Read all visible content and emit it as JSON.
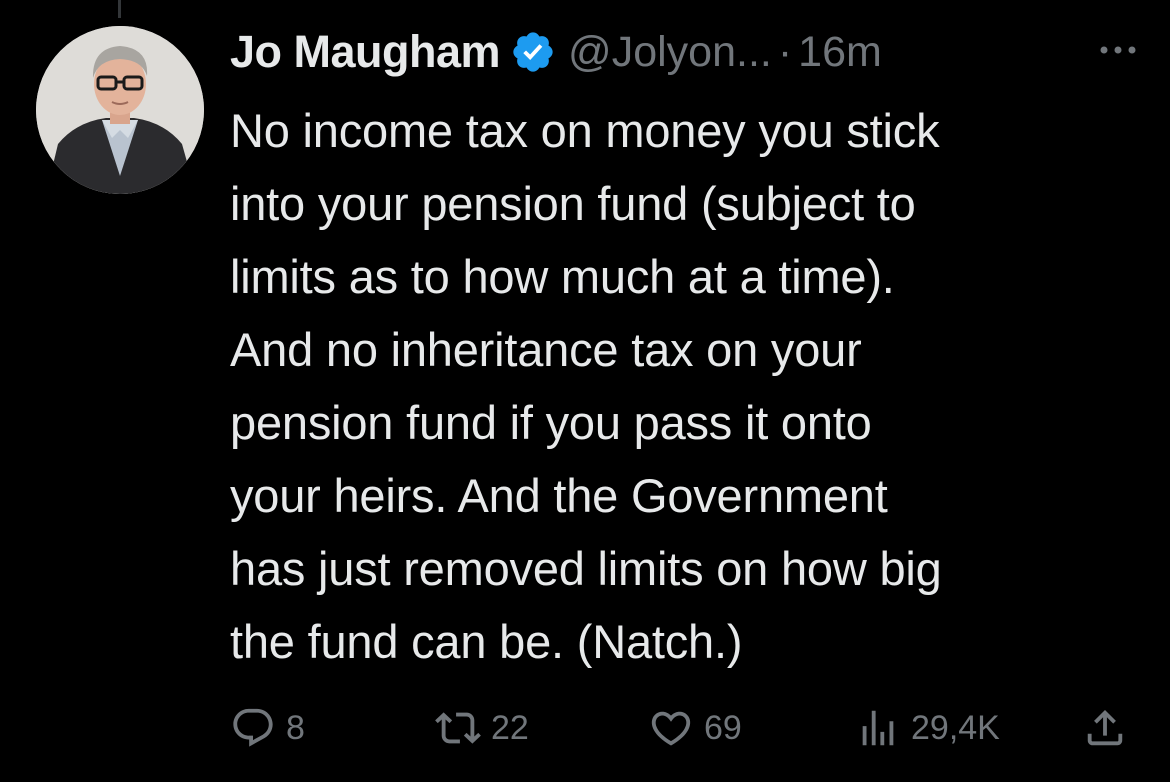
{
  "tweet": {
    "author_name": "Jo Maugham",
    "handle": "@Jolyon...",
    "separator": "·",
    "time": "16m",
    "lines": [
      "No income tax on money you stick",
      "into your pension fund (subject to",
      "limits as to how much at a time).",
      "And no inheritance tax on your",
      "pension fund if you pass it onto",
      "your heirs. And the Government",
      "has just removed limits on how big",
      "the fund can be. (Natch.)"
    ],
    "metrics": {
      "replies": "8",
      "retweets": "22",
      "likes": "69",
      "views": "29,4K"
    }
  },
  "icons": {
    "verified": "verified-badge-icon",
    "more": "more-icon",
    "reply": "reply-icon",
    "retweet": "retweet-icon",
    "like": "heart-icon",
    "views": "views-icon",
    "share": "share-icon"
  },
  "colors": {
    "background": "#000000",
    "text": "#e7e9ea",
    "secondary": "#71767b",
    "verified": "#1d9bf0"
  }
}
